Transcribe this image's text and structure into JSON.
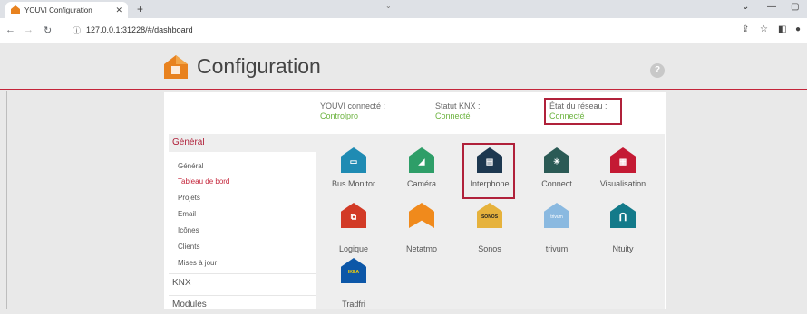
{
  "browser": {
    "tab_title": "YOUVI Configuration",
    "url": "127.0.0.1:31228/#/dashboard"
  },
  "header": {
    "title": "Configuration",
    "help_label": "?"
  },
  "status": [
    {
      "label": "YOUVI connecté :",
      "value": "Controlpro"
    },
    {
      "label": "Statut KNX :",
      "value": "Connecté"
    },
    {
      "label": "État du réseau :",
      "value": "Connecté"
    }
  ],
  "sidebar": {
    "general_label": "Général",
    "items": [
      "Général",
      "Tableau de bord",
      "Projets",
      "Email",
      "Icônes",
      "Clients",
      "Mises à jour"
    ],
    "knx_label": "KNX",
    "modules_label": "Modules"
  },
  "modules": [
    {
      "label": "Bus Monitor",
      "color": "#1f8bb3",
      "icon": "monitor-icon",
      "glyph": "▭"
    },
    {
      "label": "Caméra",
      "color": "#2e9e68",
      "icon": "camera-icon",
      "glyph": "◢"
    },
    {
      "label": "Interphone",
      "color": "#1d3850",
      "icon": "intercom-icon",
      "glyph": "▤"
    },
    {
      "label": "Connect",
      "color": "#2b5a55",
      "icon": "network-icon",
      "glyph": "✳"
    },
    {
      "label": "Visualisation",
      "color": "#c41a34",
      "icon": "visualisation-icon",
      "glyph": "▦"
    },
    {
      "label": "Logique",
      "color": "#d23a26",
      "icon": "logic-icon",
      "glyph": "⧉"
    },
    {
      "label": "Netatmo",
      "color": "#f08a1c",
      "icon": "netatmo-icon",
      "glyph": ""
    },
    {
      "label": "Sonos",
      "color": "#e6b23c",
      "icon": "sonos-icon",
      "glyph": "SONOS"
    },
    {
      "label": "trivum",
      "color": "#8ab9e0",
      "icon": "trivum-icon",
      "glyph": "trivum"
    },
    {
      "label": "Ntuity",
      "color": "#137a8a",
      "icon": "ntuity-icon",
      "glyph": "Ո"
    },
    {
      "label": "Tradfri",
      "color": "#0c57a8",
      "icon": "ikea-icon",
      "glyph": "IKEA"
    }
  ]
}
